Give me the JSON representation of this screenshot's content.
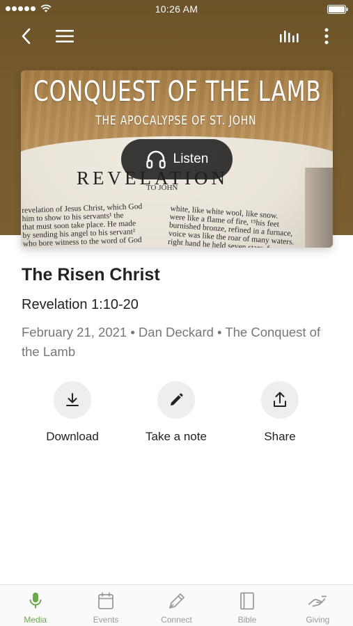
{
  "status_bar": {
    "time": "10:26 AM"
  },
  "nav": {
    "back_icon": "chevron-left-icon",
    "menu_icon": "hamburger-icon",
    "audio_icon": "audio-bars-icon",
    "more_icon": "more-vertical-icon"
  },
  "artwork": {
    "title": "CONQUEST OF THE LAMB",
    "subtitle": "THE APOCALYPSE OF ST. JOHN",
    "book_heading": "REVELATION",
    "book_subheading": "TO JOHN",
    "left_lines": [
      "revelation of Jesus Christ, which God",
      "him to show to his servants¹ the",
      "that must soon take place. He made",
      "by sending his angel to his servant²",
      "who bore witness to the word of God"
    ],
    "right_lines": [
      "white, like white wool, like snow.",
      "were like a flame of fire, ¹⁵his feet",
      "burnished bronze, refined in a furnace,",
      "voice was like the roar of many waters.",
      "right hand he held seven stars, from"
    ],
    "listen_label": "Listen",
    "listen_icon": "headphones-icon"
  },
  "sermon": {
    "title": "The Risen Christ",
    "scripture": "Revelation 1:10-20",
    "meta": "February 21, 2021 • Dan Deckard • The Conquest of the Lamb"
  },
  "actions": [
    {
      "label": "Download",
      "icon": "download-icon"
    },
    {
      "label": "Take a note",
      "icon": "pencil-icon"
    },
    {
      "label": "Share",
      "icon": "share-icon"
    }
  ],
  "tabs": [
    {
      "label": "Media",
      "icon": "microphone-icon",
      "active": true
    },
    {
      "label": "Events",
      "icon": "calendar-icon",
      "active": false
    },
    {
      "label": "Connect",
      "icon": "pen-icon",
      "active": false
    },
    {
      "label": "Bible",
      "icon": "book-icon",
      "active": false
    },
    {
      "label": "Giving",
      "icon": "giving-hand-icon",
      "active": false
    }
  ],
  "colors": {
    "header_brown": "#765b2e",
    "active_tab_green": "#6aa94a",
    "inactive_tab_gray": "#999999",
    "meta_gray": "#777777"
  }
}
